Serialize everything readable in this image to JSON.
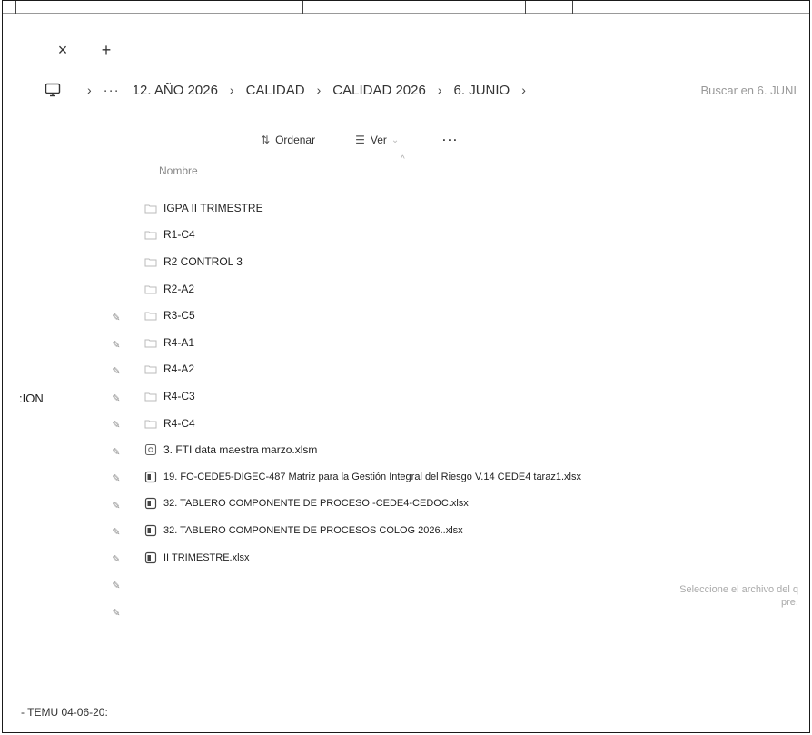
{
  "tab_bar": {
    "close_glyph": "×",
    "add_glyph": "+"
  },
  "address_bar": {
    "overflow_glyph": "···",
    "separator": "›",
    "breadcrumbs": [
      "12. AÑO 2026",
      "CALIDAD",
      "CALIDAD 2026",
      "6. JUNIO"
    ],
    "search_placeholder": "Buscar en 6. JUNI"
  },
  "toolbar": {
    "sort_label": "Ordenar",
    "view_label": "Ver",
    "more_glyph": "···"
  },
  "file_list": {
    "column_name": "Nombre",
    "items": [
      {
        "name": "IGPA II TRIMESTRE",
        "icon": "folder-icon"
      },
      {
        "name": "R1-C4",
        "icon": "folder-icon"
      },
      {
        "name": "R2 CONTROL 3",
        "icon": "folder-icon"
      },
      {
        "name": "R2-A2",
        "icon": "folder-icon"
      },
      {
        "name": "R3-C5",
        "icon": "folder-icon"
      },
      {
        "name": "R4-A1",
        "icon": "folder-icon"
      },
      {
        "name": "R4-A2",
        "icon": "folder-icon"
      },
      {
        "name": "R4-C3",
        "icon": "folder-icon"
      },
      {
        "name": "R4-C4",
        "icon": "folder-icon"
      },
      {
        "name": "3. FTI data maestra marzo.xlsm",
        "icon": "excel-macro-icon"
      },
      {
        "name": "19. FO-CEDE5-DIGEC-487 Matriz para la Gestión Integral del Riesgo V.14 CEDE4 taraz1.xlsx",
        "icon": "excel-file-icon"
      },
      {
        "name": "32. TABLERO COMPONENTE DE PROCESO -CEDE4-CEDOC.xlsx",
        "icon": "excel-file-icon"
      },
      {
        "name": "32. TABLERO COMPONENTE DE PROCESOS COLOG 2026..xlsx",
        "icon": "excel-file-icon"
      },
      {
        "name": "II TRIMESTRE.xlsx",
        "icon": "excel-file-icon"
      }
    ]
  },
  "navigation_pane": {
    "partial_label": ":ION",
    "bottom_item": "- TEMU 04-06-20:"
  },
  "preview_pane": {
    "line1": "Seleccione el archivo del q",
    "line2": "pre."
  }
}
